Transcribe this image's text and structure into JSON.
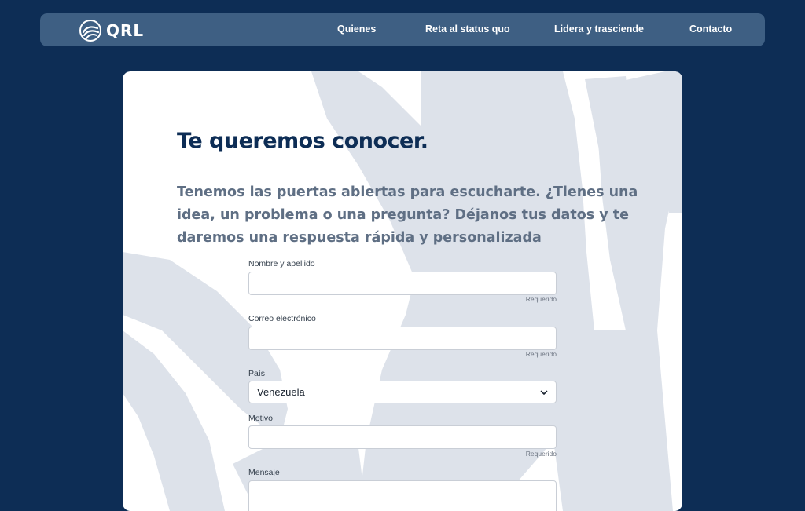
{
  "nav": {
    "logo_text": "QRL",
    "links": [
      "Quienes",
      "Reta al status quo",
      "Lidera y trasciende",
      "Contacto"
    ]
  },
  "main": {
    "title": "Te queremos conocer.",
    "intro": "Tenemos las puertas abiertas para escucharte. ¿Tienes una idea, un problema o una pregunta? Déjanos tus datos y te daremos una respuesta rápida y personalizada"
  },
  "form": {
    "name_label": "Nombre y apellido",
    "name_value": "",
    "name_required": "Requerido",
    "email_label": "Correo electrónico",
    "email_value": "",
    "email_required": "Requerido",
    "country_label": "País",
    "country_value": "Venezuela",
    "reason_label": "Motivo",
    "reason_value": "",
    "reason_required": "Requerido",
    "message_label": "Mensaje",
    "message_value": ""
  },
  "colors": {
    "background": "#0d2d55",
    "navbar": "#3e5f83",
    "brush": "#dde2ea",
    "title": "#0d2d55",
    "intro": "#5f6f84"
  }
}
